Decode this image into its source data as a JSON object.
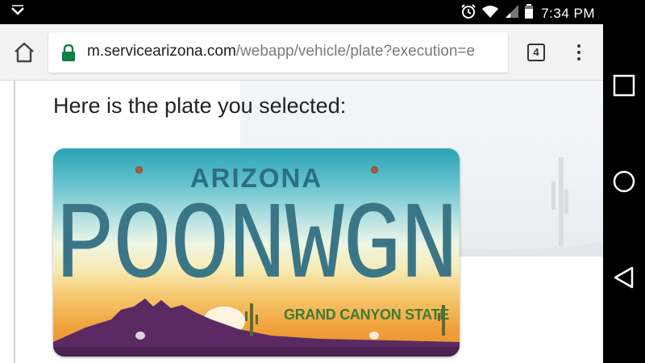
{
  "status_bar": {
    "time": "7:34 PM",
    "icons": [
      "notification-chevron-icon",
      "alarm-icon",
      "wifi-icon",
      "signal-icon",
      "battery-icon"
    ]
  },
  "browser": {
    "url_domain": "m.servicearizona.com",
    "url_path": "/webapp/vehicle/plate?execution=e",
    "tab_count": "4"
  },
  "page": {
    "heading": "Here is the plate you selected:"
  },
  "plate": {
    "state": "ARIZONA",
    "number": "POONWGN",
    "slogan": "GRAND CANYON STATE"
  },
  "nav_bar": {
    "buttons": [
      "recents-square-icon",
      "home-circle-icon",
      "back-triangle-icon"
    ]
  },
  "colors": {
    "secure_lock": "#0b8043",
    "plate_text": "#3b7687",
    "plate_state": "#2c6e85",
    "plate_slogan": "#3f7a37",
    "mountains": "#5b2a62"
  }
}
